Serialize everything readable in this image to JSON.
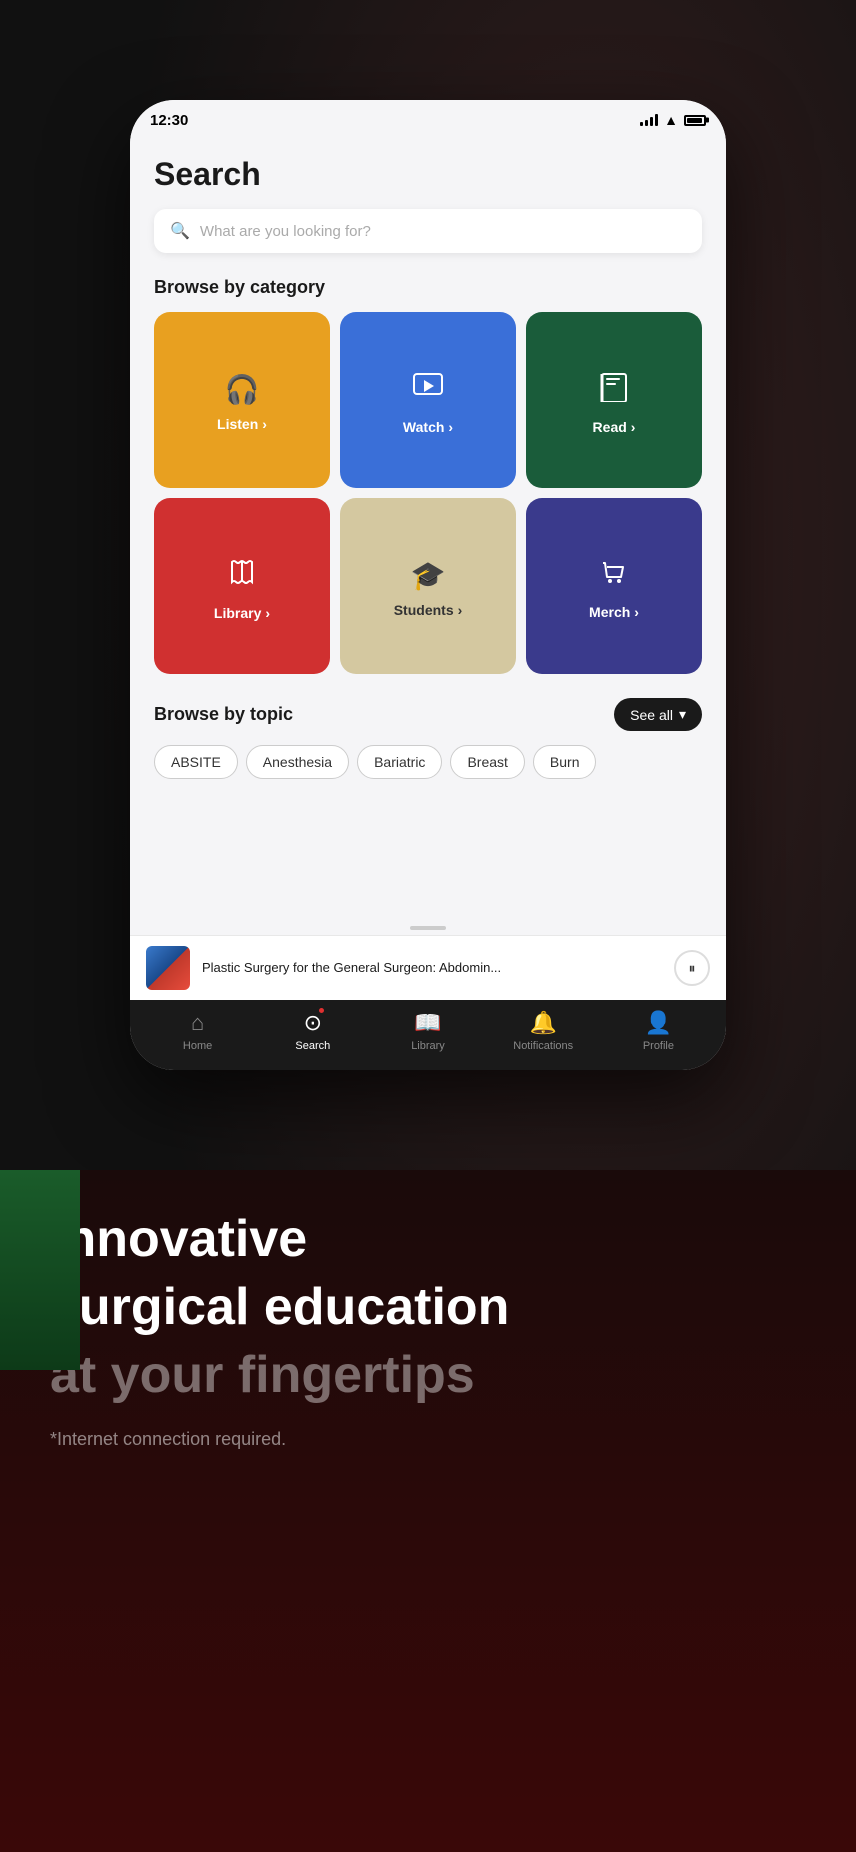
{
  "status_bar": {
    "time": "12:30"
  },
  "page": {
    "title": "Search",
    "search_placeholder": "What are you looking for?"
  },
  "categories": {
    "section_title": "Browse by category",
    "items": [
      {
        "id": "listen",
        "label": "Listen",
        "icon": "🎧",
        "color": "card-listen"
      },
      {
        "id": "watch",
        "label": "Watch",
        "icon": "▶",
        "color": "card-watch"
      },
      {
        "id": "read",
        "label": "Read",
        "icon": "📚",
        "color": "card-read"
      },
      {
        "id": "library",
        "label": "Library",
        "icon": "📖",
        "color": "card-library"
      },
      {
        "id": "students",
        "label": "Students",
        "icon": "🎓",
        "color": "card-students"
      },
      {
        "id": "merch",
        "label": "Merch",
        "icon": "🛒",
        "color": "card-merch"
      }
    ]
  },
  "topics": {
    "section_title": "Browse by topic",
    "see_all_label": "See all",
    "chips": [
      "ABSITE",
      "Anesthesia",
      "Bariatric",
      "Breast",
      "Burn"
    ]
  },
  "now_playing": {
    "title": "Plastic Surgery for the General Surgeon: Abdomin..."
  },
  "bottom_nav": {
    "items": [
      {
        "id": "home",
        "label": "Home",
        "icon": "⌂",
        "active": false
      },
      {
        "id": "search",
        "label": "Search",
        "icon": "⊙",
        "active": true,
        "has_dot": true
      },
      {
        "id": "library",
        "label": "Library",
        "icon": "📖",
        "active": false
      },
      {
        "id": "notifications",
        "label": "Notifications",
        "icon": "🔔",
        "active": false
      },
      {
        "id": "profile",
        "label": "Profile",
        "icon": "👤",
        "active": false
      }
    ]
  },
  "marketing": {
    "headline_line1": "Innovative",
    "headline_line2": "surgical education",
    "subline": "at your fingertips",
    "disclaimer": "*Internet connection required."
  }
}
